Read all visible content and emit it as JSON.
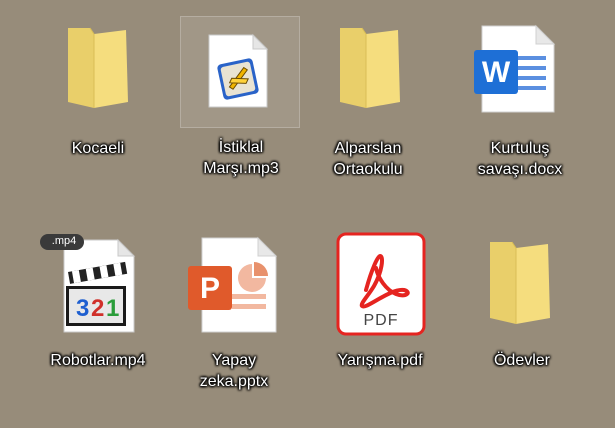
{
  "desktop": {
    "items": [
      {
        "label": "Kocaeli",
        "icon": "folder-icon",
        "type": "folder"
      },
      {
        "label": "İstiklal\nMarşı.mp3",
        "icon": "winamp-audio-file-icon",
        "type": "file"
      },
      {
        "label": "Alparslan\nOrtaokulu",
        "icon": "folder-icon",
        "type": "folder"
      },
      {
        "label": "Kurtuluş\nsavaşı.docx",
        "icon": "word-document-icon",
        "type": "file"
      },
      {
        "label": "Robotlar.mp4",
        "icon": "video-file-icon",
        "type": "file",
        "badge": ".mp4"
      },
      {
        "label": "Yapay\nzeka.pptx",
        "icon": "powerpoint-document-icon",
        "type": "file"
      },
      {
        "label": "Yarışma.pdf",
        "icon": "pdf-document-icon",
        "type": "file",
        "badge": "PDF"
      },
      {
        "label": "Ödevler",
        "icon": "folder-icon",
        "type": "folder"
      }
    ]
  },
  "colors": {
    "desktop_background": "#978c7a",
    "folder": "#f5dd7e",
    "word_blue": "#1e6fd6",
    "powerpoint_orange": "#e05a2b",
    "pdf_red": "#e52420"
  }
}
